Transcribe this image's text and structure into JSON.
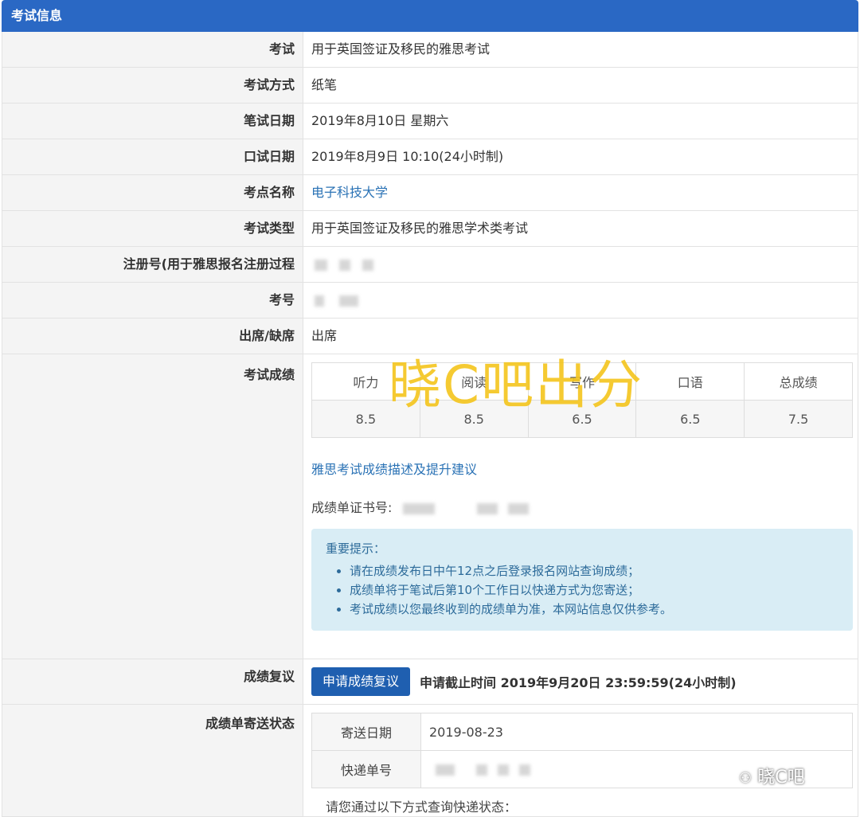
{
  "section_title": "考试信息",
  "fields": [
    {
      "label": "考试",
      "value": "用于英国签证及移民的雅思考试"
    },
    {
      "label": "考试方式",
      "value": "纸笔"
    },
    {
      "label": "笔试日期",
      "value": "2019年8月10日 星期六"
    },
    {
      "label": "口试日期",
      "value": "2019年8月9日 10:10(24小时制)"
    },
    {
      "label": "考点名称",
      "value": "电子科技大学"
    },
    {
      "label": "考试类型",
      "value": "用于英国签证及移民的雅思学术类考试"
    },
    {
      "label": "注册号(用于雅思报名注册过程",
      "value": ""
    },
    {
      "label": "考号",
      "value": ""
    },
    {
      "label": "出席/缺席",
      "value": "出席"
    }
  ],
  "scores": {
    "label": "考试成绩",
    "headers": [
      "听力",
      "阅读",
      "写作",
      "口语",
      "总成绩"
    ],
    "values": [
      "8.5",
      "8.5",
      "6.5",
      "6.5",
      "7.5"
    ],
    "advice_link": "雅思考试成绩描述及提升建议",
    "certificate_label": "成绩单证书号:"
  },
  "notice": {
    "title": "重要提示：",
    "items": [
      "请在成绩发布日中午12点之后登录报名网站查询成绩；",
      "成绩单将于笔试后第10个工作日以快递方式为您寄送；",
      "考试成绩以您最终收到的成绩单为准，本网站信息仅供参考。"
    ]
  },
  "review": {
    "label": "成绩复议",
    "button": "申请成绩复议",
    "deadline": "申请截止时间 2019年9月20日 23:59:59(24小时制)"
  },
  "shipping": {
    "label": "成绩单寄送状态",
    "date_label": "寄送日期",
    "date_value": "2019-08-23",
    "tracking_label": "快递单号",
    "query_text": "请您通过以下方式查询快递状态："
  },
  "watermark": "晓C吧出分",
  "brand": "晓C吧",
  "colors": {
    "header": "#2a68c4",
    "button": "#1f5fb0",
    "notice_bg": "#d9edf5",
    "link": "#2a72b5",
    "watermark": "#f4c51c"
  }
}
